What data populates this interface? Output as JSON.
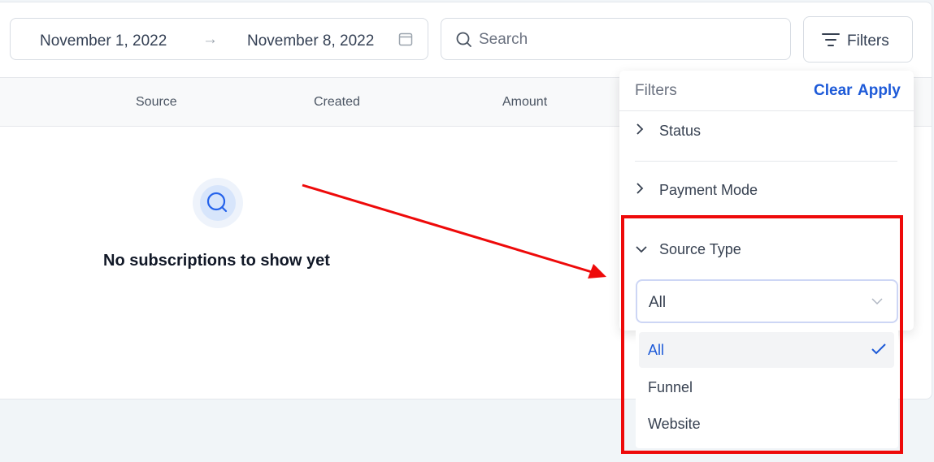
{
  "date_range": {
    "start": "November 1, 2022",
    "arrow": "→",
    "end": "November 8, 2022",
    "icon": "calendar-icon"
  },
  "search": {
    "placeholder": "Search",
    "icon": "search-icon"
  },
  "filters_button": {
    "label": "Filters",
    "icon": "filter-lines-icon"
  },
  "table": {
    "columns": [
      "Source",
      "Created",
      "Amount"
    ]
  },
  "empty_state": {
    "icon": "search-icon",
    "text": "No subscriptions to show yet"
  },
  "filter_panel": {
    "title": "Filters",
    "clear": "Clear",
    "apply": "Apply",
    "sections": [
      {
        "label": "Status",
        "expanded": false
      },
      {
        "label": "Payment Mode",
        "expanded": false
      },
      {
        "label": "Source Type",
        "expanded": true
      }
    ],
    "source_type": {
      "selected": "All",
      "options": [
        "All",
        "Funnel",
        "Website"
      ]
    }
  },
  "colors": {
    "accent": "#1d5ad8",
    "annotation_red": "#ee0a0a"
  }
}
